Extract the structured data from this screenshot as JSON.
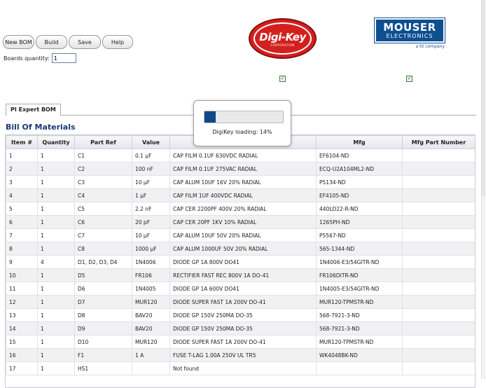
{
  "toolbar": {
    "new_bom": "New BOM",
    "build": "Build",
    "save": "Save",
    "help": "Help"
  },
  "boards": {
    "label": "Boards quantity:",
    "value": "1"
  },
  "logos": {
    "digikey": {
      "name": "Digi-Key",
      "sub": "CORPORATION"
    },
    "mouser": {
      "line1": "MOUSER",
      "line2": "ELECTRONICS",
      "line3": "a tti company"
    }
  },
  "suppliers": {
    "digikey_checked": true,
    "mouser_checked": true,
    "check_glyph": "✓"
  },
  "tab": {
    "label": "PI Expert BOM"
  },
  "section_title": "Bill Of Materials",
  "loading": {
    "text": "DigiKey loading: 14%",
    "progress": 0.14
  },
  "table": {
    "columns": [
      "Item #",
      "Quantity",
      "Part Ref",
      "Value",
      "",
      "Mfg",
      "Mfg Part Number"
    ],
    "rows": [
      [
        "1",
        "1",
        "C1",
        "0.1 µF",
        "CAP FILM 0.1UF 630VDC RADIAL",
        "EF6104-ND",
        ""
      ],
      [
        "2",
        "1",
        "C2",
        "100 nF",
        "CAP FILM 0.1UF 275VAC RADIAL",
        "ECQ-U2A104ML2-ND",
        ""
      ],
      [
        "3",
        "1",
        "C3",
        "10 µF",
        "CAP ALUM 10UF 16V 20% RADIAL",
        "P5134-ND",
        ""
      ],
      [
        "4",
        "1",
        "C4",
        "1 µF",
        "CAP FILM 1UF 400VDC RADIAL",
        "EF4105-ND",
        ""
      ],
      [
        "5",
        "1",
        "C5",
        "2.2 nF",
        "CAP CER 2200PF 400V 20% RADIAL",
        "440LD22-R-ND",
        ""
      ],
      [
        "6",
        "1",
        "C6",
        "20 pF",
        "CAP CER 20PF 1KV 10% RADIAL",
        "1265PH-ND",
        ""
      ],
      [
        "7",
        "1",
        "C7",
        "10 µF",
        "CAP ALUM 10UF 50V 20% RADIAL",
        "P5567-ND",
        ""
      ],
      [
        "8",
        "1",
        "C8",
        "1000 µF",
        "CAP ALUM 1000UF 50V 20% RADIAL",
        "565-1344-ND",
        ""
      ],
      [
        "9",
        "4",
        "D1, D2, D3, D4",
        "1N4006",
        "DIODE GP 1A 800V DO41",
        "1N4006-E3/54GITR-ND",
        ""
      ],
      [
        "10",
        "1",
        "D5",
        "FR106",
        "RECTIFIER FAST REC 800V 1A DO-41",
        "FR106DITR-ND",
        ""
      ],
      [
        "11",
        "1",
        "D6",
        "1N4005",
        "DIODE GP 1A 600V DO41",
        "1N4005-E3/54GITR-ND",
        ""
      ],
      [
        "12",
        "1",
        "D7",
        "MUR120",
        "DIODE SUPER FAST 1A 200V DO-41",
        "MUR120-TPMSTR-ND",
        ""
      ],
      [
        "13",
        "1",
        "D8",
        "BAV20",
        "DIODE GP 150V 250MA DO-35",
        "568-7921-3-ND",
        ""
      ],
      [
        "14",
        "1",
        "D9",
        "BAV20",
        "DIODE GP 150V 250MA DO-35",
        "568-7921-3-ND",
        ""
      ],
      [
        "15",
        "1",
        "D10",
        "MUR120",
        "DIODE SUPER FAST 1A 200V DO-41",
        "MUR120-TPMSTR-ND",
        ""
      ],
      [
        "16",
        "1",
        "F1",
        "1 A",
        "FUSE T-LAG 1.00A 250V UL TR5",
        "WK4048BK-ND",
        ""
      ],
      [
        "17",
        "1",
        "HS1",
        "",
        "Not found",
        "",
        ""
      ]
    ]
  }
}
